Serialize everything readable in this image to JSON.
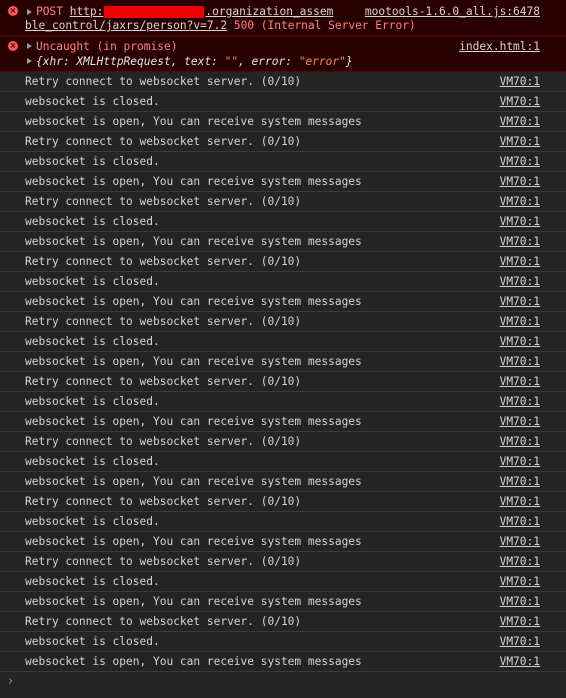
{
  "errors": {
    "post": {
      "method": "POST",
      "url_start": "http:",
      "url_end": ".organization_assem",
      "url_line2": "ble_control/jaxrs/person?v=7.2",
      "status": "500 (Internal Server Error)",
      "source": "mootools-1.6.0_all.js:6478"
    },
    "uncaught": {
      "label": "Uncaught (in promise)",
      "source": "index.html:1",
      "obj_prefix": "{xhr: XMLHttpRequest, text: ",
      "text_val": "\"\"",
      "obj_mid": ", error: ",
      "error_val": "\"error\"",
      "obj_suffix": "}"
    }
  },
  "log": [
    {
      "msg": "Retry connect to websocket server. (0/10)",
      "src": "VM70:1"
    },
    {
      "msg": "websocket is closed.",
      "src": "VM70:1"
    },
    {
      "msg": "websocket is open, You can receive system messages",
      "src": "VM70:1"
    },
    {
      "msg": "Retry connect to websocket server. (0/10)",
      "src": "VM70:1"
    },
    {
      "msg": "websocket is closed.",
      "src": "VM70:1"
    },
    {
      "msg": "websocket is open, You can receive system messages",
      "src": "VM70:1"
    },
    {
      "msg": "Retry connect to websocket server. (0/10)",
      "src": "VM70:1"
    },
    {
      "msg": "websocket is closed.",
      "src": "VM70:1"
    },
    {
      "msg": "websocket is open, You can receive system messages",
      "src": "VM70:1"
    },
    {
      "msg": "Retry connect to websocket server. (0/10)",
      "src": "VM70:1"
    },
    {
      "msg": "websocket is closed.",
      "src": "VM70:1"
    },
    {
      "msg": "websocket is open, You can receive system messages",
      "src": "VM70:1"
    },
    {
      "msg": "Retry connect to websocket server. (0/10)",
      "src": "VM70:1"
    },
    {
      "msg": "websocket is closed.",
      "src": "VM70:1"
    },
    {
      "msg": "websocket is open, You can receive system messages",
      "src": "VM70:1"
    },
    {
      "msg": "Retry connect to websocket server. (0/10)",
      "src": "VM70:1"
    },
    {
      "msg": "websocket is closed.",
      "src": "VM70:1"
    },
    {
      "msg": "websocket is open, You can receive system messages",
      "src": "VM70:1"
    },
    {
      "msg": "Retry connect to websocket server. (0/10)",
      "src": "VM70:1"
    },
    {
      "msg": "websocket is closed.",
      "src": "VM70:1"
    },
    {
      "msg": "websocket is open, You can receive system messages",
      "src": "VM70:1"
    },
    {
      "msg": "Retry connect to websocket server. (0/10)",
      "src": "VM70:1"
    },
    {
      "msg": "websocket is closed.",
      "src": "VM70:1"
    },
    {
      "msg": "websocket is open, You can receive system messages",
      "src": "VM70:1"
    },
    {
      "msg": "Retry connect to websocket server. (0/10)",
      "src": "VM70:1"
    },
    {
      "msg": "websocket is closed.",
      "src": "VM70:1"
    },
    {
      "msg": "websocket is open, You can receive system messages",
      "src": "VM70:1"
    },
    {
      "msg": "Retry connect to websocket server. (0/10)",
      "src": "VM70:1"
    },
    {
      "msg": "websocket is closed.",
      "src": "VM70:1"
    },
    {
      "msg": "websocket is open, You can receive system messages",
      "src": "VM70:1"
    }
  ],
  "prompt": {
    "chevron": "›"
  },
  "icons": {
    "error": "error-icon",
    "expand": "expand-triangle-icon",
    "prompt": "prompt-chevron-icon"
  },
  "colors": {
    "background": "#242424",
    "error_bg": "#290000",
    "error_text": "#ff8080",
    "prompt": "#5a9bf0"
  }
}
